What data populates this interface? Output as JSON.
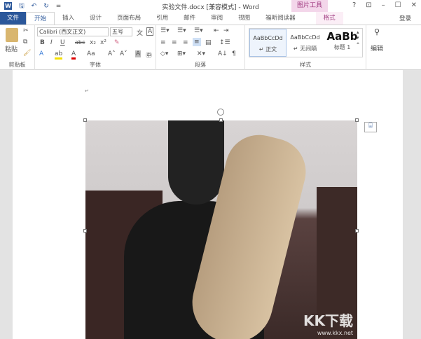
{
  "titlebar": {
    "title": "实验文件.docx [兼容模式] - Word",
    "context_tab": "图片工具",
    "help": "?",
    "restore": "⊡",
    "minimize": "–",
    "maximize": "☐",
    "close": "✕",
    "app_icon": "W",
    "save": "🖫",
    "undo": "↶",
    "redo": "↻",
    "customize": "="
  },
  "tabs": [
    "文件",
    "开始",
    "插入",
    "设计",
    "页面布局",
    "引用",
    "邮件",
    "审阅",
    "视图",
    "福昕阅读器",
    "格式"
  ],
  "login": "登录",
  "ribbon": {
    "clipboard": {
      "label": "剪贴板",
      "paste": "粘贴"
    },
    "font": {
      "label": "字体",
      "name": "Calibri (西文正文)",
      "size": "五号",
      "bold": "B",
      "italic": "I",
      "underline": "U",
      "strike": "abc",
      "sub": "x₂",
      "sup": "x²",
      "grow": "A˄",
      "shrink": "A˅",
      "case": "Aa"
    },
    "paragraph": {
      "label": "段落"
    },
    "styles": {
      "label": "样式",
      "items": [
        {
          "preview": "AaBbCcDd",
          "name": "↵ 正文"
        },
        {
          "preview": "AaBbCcDd",
          "name": "↵ 无间隔"
        },
        {
          "preview": "AaBb",
          "name": "标题 1"
        }
      ]
    },
    "editing": {
      "label": "编辑"
    }
  },
  "document": {
    "paragraph_mark": "↵"
  },
  "watermark": {
    "brand": "KK下载",
    "url": "www.kkx.net"
  }
}
